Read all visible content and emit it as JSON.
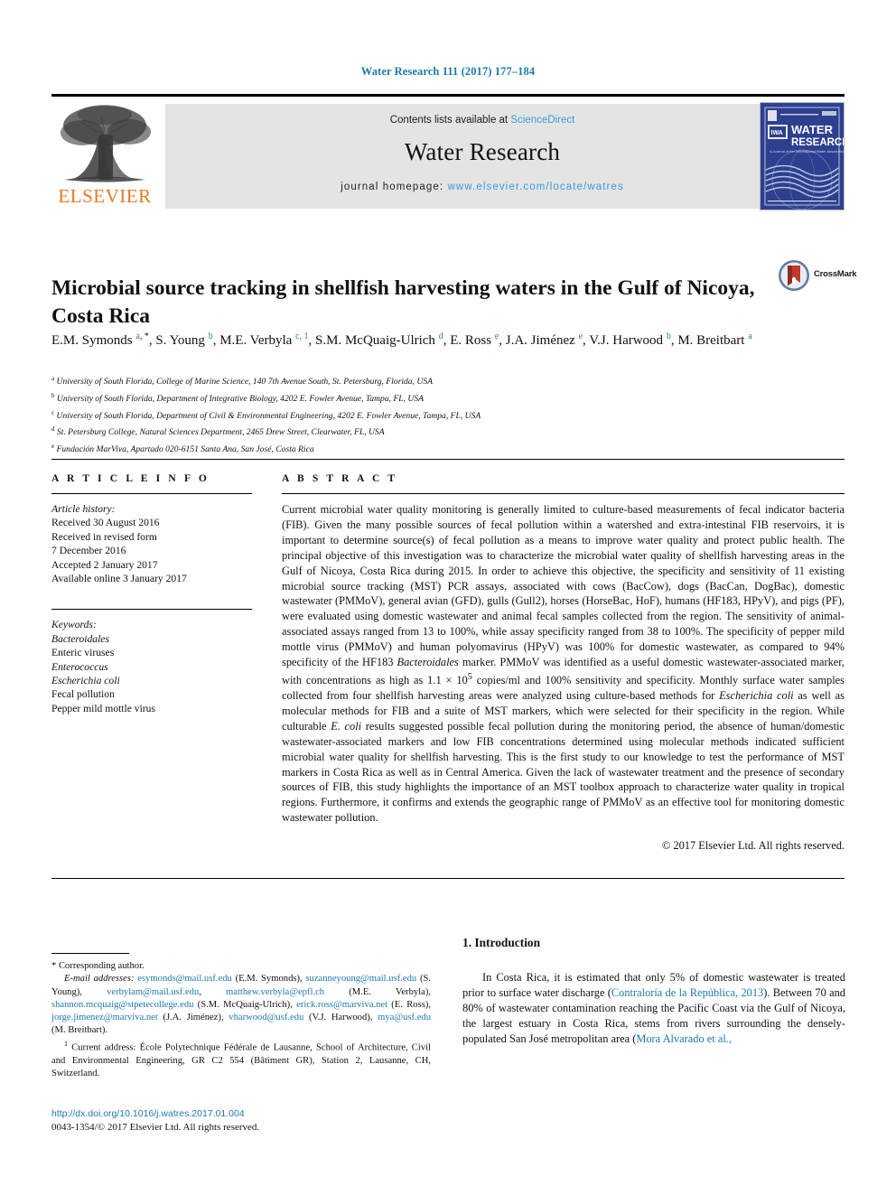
{
  "running_head": "Water Research 111 (2017) 177–184",
  "masthead": {
    "elsevier_wordmark": "ELSEVIER",
    "contents_prefix": "Contents lists available at ",
    "sciencedirect": "ScienceDirect",
    "journal_title": "Water Research",
    "homepage_prefix": "journal homepage: ",
    "homepage_url": "www.elsevier.com/locate/watres",
    "cover_line1": "WATER",
    "cover_line2": "RESEARCH",
    "cover_tagline": "A Journal of the International Water Association"
  },
  "article": {
    "title": "Microbial source tracking in shellfish harvesting waters in the Gulf of Nicoya, Costa Rica",
    "crossmark_label": "CrossMark",
    "authors_html": "E.M. Symonds <sup>a</sup><sup class=\"star\">, *</sup>, S. Young <sup>b</sup>, M.E. Verbyla <sup>c, 1</sup>, S.M. McQuaig-Ulrich <sup>d</sup>, E. Ross <sup>e</sup>, J.A. Jiménez <sup>e</sup>, V.J. Harwood <sup>b</sup>, M. Breitbart <sup>a</sup>",
    "affiliations": [
      {
        "marker": "a",
        "text": "University of South Florida, College of Marine Science, 140 7th Avenue South, St. Petersburg, Florida, USA"
      },
      {
        "marker": "b",
        "text": "University of South Florida, Department of Integrative Biology, 4202 E. Fowler Avenue, Tampa, FL, USA"
      },
      {
        "marker": "c",
        "text": "University of South Florida, Department of Civil & Environmental Engineering, 4202 E. Fowler Avenue, Tampa, FL, USA"
      },
      {
        "marker": "d",
        "text": "St. Petersburg College, Natural Sciences Department, 2465 Drew Street, Clearwater, FL, USA"
      },
      {
        "marker": "e",
        "text": "Fundación MarViva, Apartado 020-6151 Santa Ana, San José, Costa Rica"
      }
    ]
  },
  "article_info": {
    "heading": "A R T I C L E   I N F O",
    "history_label": "Article history:",
    "history": [
      "Received 30 August 2016",
      "Received in revised form",
      "7 December 2016",
      "Accepted 2 January 2017",
      "Available online 3 January 2017"
    ],
    "keywords_label": "Keywords:",
    "keywords": [
      {
        "text": "Bacteroidales",
        "italic": true
      },
      {
        "text": "Enteric viruses",
        "italic": false
      },
      {
        "text": "Enterococcus",
        "italic": true
      },
      {
        "text": "Escherichia coli",
        "italic": true
      },
      {
        "text": "Fecal pollution",
        "italic": false
      },
      {
        "text": "Pepper mild mottle virus",
        "italic": false
      }
    ]
  },
  "abstract": {
    "heading": "A B S T R A C T",
    "body_html": "Current microbial water quality monitoring is generally limited to culture-based measurements of fecal indicator bacteria (FIB). Given the many possible sources of fecal pollution within a watershed and extra-intestinal FIB reservoirs, it is important to determine source(s) of fecal pollution as a means to improve water quality and protect public health. The principal objective of this investigation was to characterize the microbial water quality of shellfish harvesting areas in the Gulf of Nicoya, Costa Rica during 2015. In order to achieve this objective, the specificity and sensitivity of 11 existing microbial source tracking (MST) PCR assays, associated with cows (BacCow), dogs (BacCan, DogBac), domestic wastewater (PMMoV), general avian (GFD), gulls (Gull2), horses (HorseBac, HoF), humans (HF183, HPyV), and pigs (PF), were evaluated using domestic wastewater and animal fecal samples collected from the region. The sensitivity of animal-associated assays ranged from 13 to 100%, while assay specificity ranged from 38 to 100%. The specificity of pepper mild mottle virus (PMMoV) and human polyomavirus (HPyV) was 100% for domestic wastewater, as compared to 94% specificity of the HF183 <i>Bacteroidales</i> marker. PMMoV was identified as a useful domestic wastewater-associated marker, with concentrations as high as 1.1 &times; 10<sup>5</sup> copies/ml and 100% sensitivity and specificity. Monthly surface water samples collected from four shellfish harvesting areas were analyzed using culture-based methods for <i>Escherichia coli</i> as well as molecular methods for FIB and a suite of MST markers, which were selected for their specificity in the region. While culturable <i>E. coli</i> results suggested possible fecal pollution during the monitoring period, the absence of human/domestic wastewater-associated markers and low FIB concentrations determined using molecular methods indicated sufficient microbial water quality for shellfish harvesting. This is the first study to our knowledge to test the performance of MST markers in Costa Rica as well as in Central America. Given the lack of wastewater treatment and the presence of secondary sources of FIB, this study highlights the importance of an MST toolbox approach to characterize water quality in tropical regions. Furthermore, it confirms and extends the geographic range of PMMoV as an effective tool for monitoring domestic wastewater pollution.",
    "copyright": "© 2017 Elsevier Ltd. All rights reserved."
  },
  "footnotes": {
    "corresponding": "* Corresponding author.",
    "emails_label": "E-mail addresses:",
    "emails_html": "<span class=\"mail-link\">esymonds@mail.usf.edu</span> (E.M. Symonds), <span class=\"mail-link\">suzanneyoung@mail.usf.edu</span> (S. Young), <span class=\"mail-link\">verbylam@mail.usf.edu</span>, <span class=\"mail-link\">matthew.verbyla@epfl.ch</span> (M.E. Verbyla), <span class=\"mail-link\">shannon.mcquaig@stpetecollege.edu</span> (S.M. McQuaig-Ulrich), <span class=\"mail-link\">erick.ross@marviva.net</span> (E. Ross), <span class=\"mail-link\">jorge.jimenez@marviva.net</span> (J.A. Jiménez), <span class=\"mail-link\">vharwood@usf.edu</span> (V.J. Harwood), <span class=\"mail-link\">mya@usf.edu</span> (M. Breitbart).",
    "current_address": "Current address: École Polytechnique Fédérale de Lausanne, School of Architecture, Civil and Environmental Engineering, GR C2 554 (Bâtiment GR), Station 2, Lausanne, CH, Switzerland.",
    "current_address_marker": "1"
  },
  "doi_block": {
    "doi_url": "http://dx.doi.org/10.1016/j.watres.2017.01.004",
    "issn_line": "0043-1354/© 2017 Elsevier Ltd. All rights reserved."
  },
  "introduction": {
    "heading": "1. Introduction",
    "body_html": "In Costa Rica, it is estimated that only 5% of domestic wastewater is treated prior to surface water discharge (<span class=\"cite\">Contraloría de la República, 2013</span>). Between 70 and 80% of wastewater contamination reaching the Pacific Coast via the Gulf of Nicoya, the largest estuary in Costa Rica, stems from rivers surrounding the densely-populated San José metropolitan area (<span class=\"cite\">Mora Alvarado et al.,</span>"
  },
  "colors": {
    "link_blue": "#1a7aab",
    "sd_blue": "#3b9ad9",
    "elsevier_orange": "#E87722",
    "cover_blue": "#2d3f8f",
    "grey_box": "#e4e4e4"
  }
}
